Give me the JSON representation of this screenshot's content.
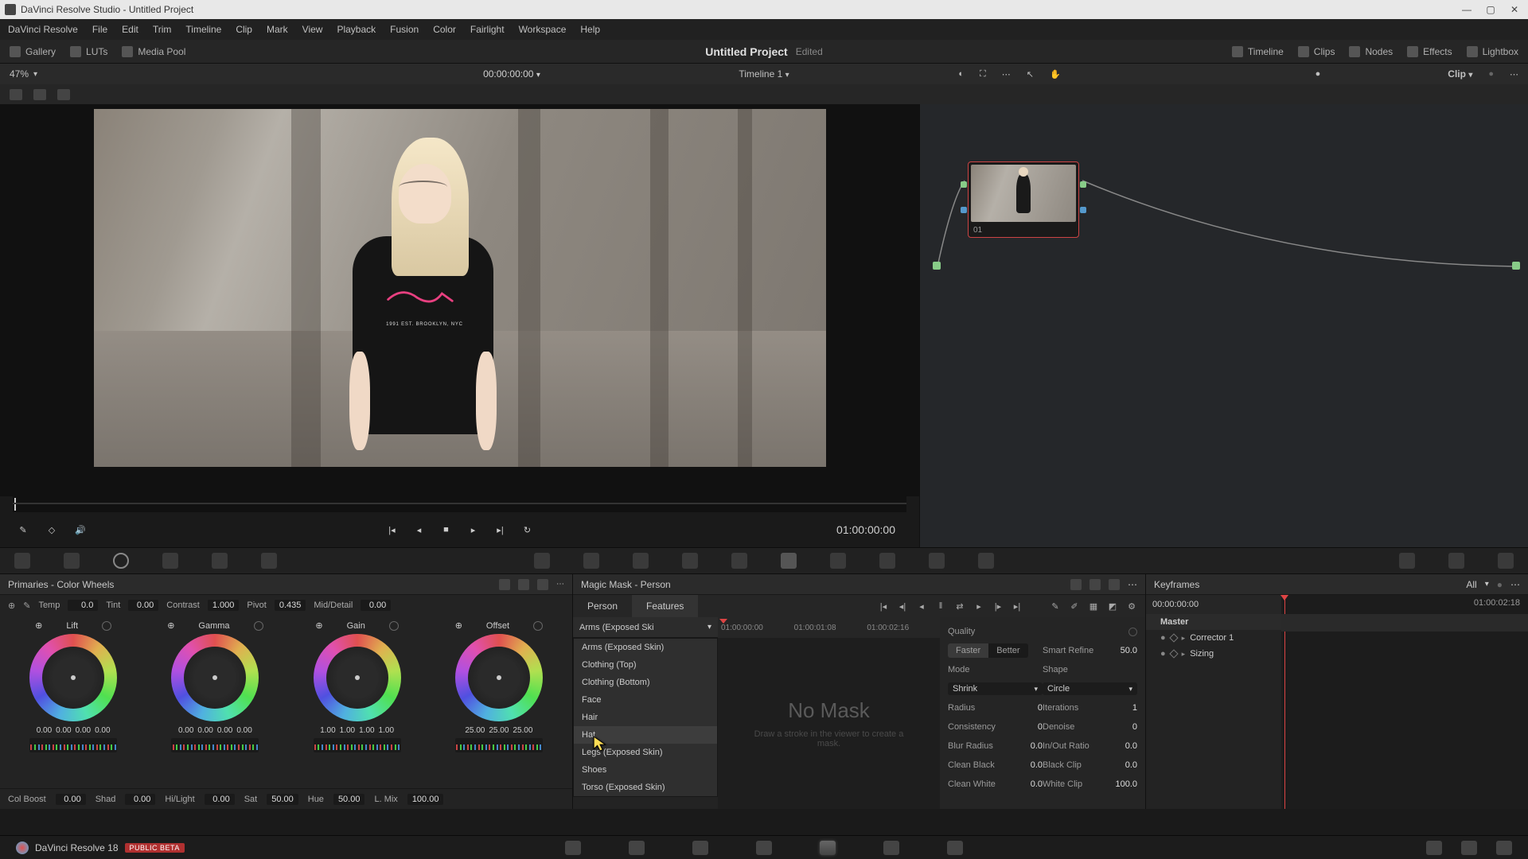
{
  "window": {
    "title": "DaVinci Resolve Studio - Untitled Project"
  },
  "menubar": [
    "DaVinci Resolve",
    "File",
    "Edit",
    "Trim",
    "Timeline",
    "Clip",
    "Mark",
    "View",
    "Playback",
    "Fusion",
    "Color",
    "Fairlight",
    "Workspace",
    "Help"
  ],
  "toolbar": {
    "left": [
      {
        "name": "gallery",
        "label": "Gallery"
      },
      {
        "name": "luts",
        "label": "LUTs"
      },
      {
        "name": "mediapool",
        "label": "Media Pool"
      }
    ],
    "project": "Untitled Project",
    "edited": "Edited",
    "right": [
      {
        "name": "timeline",
        "label": "Timeline"
      },
      {
        "name": "clips",
        "label": "Clips"
      },
      {
        "name": "nodes",
        "label": "Nodes"
      },
      {
        "name": "effects",
        "label": "Effects"
      },
      {
        "name": "lightbox",
        "label": "Lightbox"
      }
    ]
  },
  "viewer_bar": {
    "zoom": "47%",
    "timeline_name": "Timeline 1",
    "timecode": "00:00:00:00",
    "clip_dd": "Clip"
  },
  "viewer_image": {
    "logo_text": "1991 EST. BROOKLYN, NYC"
  },
  "transport": {
    "timecode": "01:00:00:00"
  },
  "nodes": {
    "node1_label": "01"
  },
  "primaries": {
    "title": "Primaries - Color Wheels",
    "top_params": [
      {
        "label": "Temp",
        "value": "0.0"
      },
      {
        "label": "Tint",
        "value": "0.00"
      },
      {
        "label": "Contrast",
        "value": "1.000"
      },
      {
        "label": "Pivot",
        "value": "0.435"
      },
      {
        "label": "Mid/Detail",
        "value": "0.00"
      }
    ],
    "wheels": [
      {
        "name": "Lift",
        "vals": [
          "0.00",
          "0.00",
          "0.00",
          "0.00"
        ]
      },
      {
        "name": "Gamma",
        "vals": [
          "0.00",
          "0.00",
          "0.00",
          "0.00"
        ]
      },
      {
        "name": "Gain",
        "vals": [
          "1.00",
          "1.00",
          "1.00",
          "1.00"
        ]
      },
      {
        "name": "Offset",
        "vals": [
          "25.00",
          "25.00",
          "25.00"
        ]
      }
    ],
    "bottom_params": [
      {
        "label": "Col Boost",
        "value": "0.00"
      },
      {
        "label": "Shad",
        "value": "0.00"
      },
      {
        "label": "Hi/Light",
        "value": "0.00"
      },
      {
        "label": "Sat",
        "value": "50.00"
      },
      {
        "label": "Hue",
        "value": "50.00"
      },
      {
        "label": "L. Mix",
        "value": "100.00"
      }
    ]
  },
  "magicmask": {
    "title": "Magic Mask - Person",
    "tabs": [
      "Person",
      "Features"
    ],
    "active_tab": 1,
    "feature_dd": "Arms (Exposed Ski",
    "feature_options": [
      "Arms (Exposed Skin)",
      "Clothing (Top)",
      "Clothing (Bottom)",
      "Face",
      "Hair",
      "Hat",
      "Legs (Exposed Skin)",
      "Shoes",
      "Torso (Exposed Skin)"
    ],
    "timeline_ticks": [
      "01:00:00:00",
      "01:00:01:08",
      "01:00:02:16"
    ],
    "nomask_title": "No Mask",
    "nomask_hint": "Draw a stroke in the viewer to create a mask.",
    "props": {
      "quality_label": "Quality",
      "quality_options": [
        "Faster",
        "Better"
      ],
      "quality_active": 0,
      "smart_refine_label": "Smart Refine",
      "smart_refine": "50.0",
      "mode_label": "Mode",
      "mode_value": "Shrink",
      "shape_label": "Shape",
      "shape_value": "Circle",
      "rows": [
        {
          "l": "Radius",
          "lv": "0",
          "r": "Iterations",
          "rv": "1"
        },
        {
          "l": "Consistency",
          "lv": "0",
          "r": "Denoise",
          "rv": "0"
        },
        {
          "l": "Blur Radius",
          "lv": "0.0",
          "r": "In/Out Ratio",
          "rv": "0.0"
        },
        {
          "l": "Clean Black",
          "lv": "0.0",
          "r": "Black Clip",
          "rv": "0.0"
        },
        {
          "l": "Clean White",
          "lv": "0.0",
          "r": "White Clip",
          "rv": "100.0"
        }
      ]
    }
  },
  "keyframes": {
    "title": "Keyframes",
    "all_label": "All",
    "tc_left": "00:00:00:00",
    "tc_right": "01:00:02:18",
    "tree": [
      "Master",
      "Corrector 1",
      "Sizing"
    ]
  },
  "footer": {
    "app": "DaVinci Resolve 18",
    "badge": "PUBLIC BETA"
  }
}
